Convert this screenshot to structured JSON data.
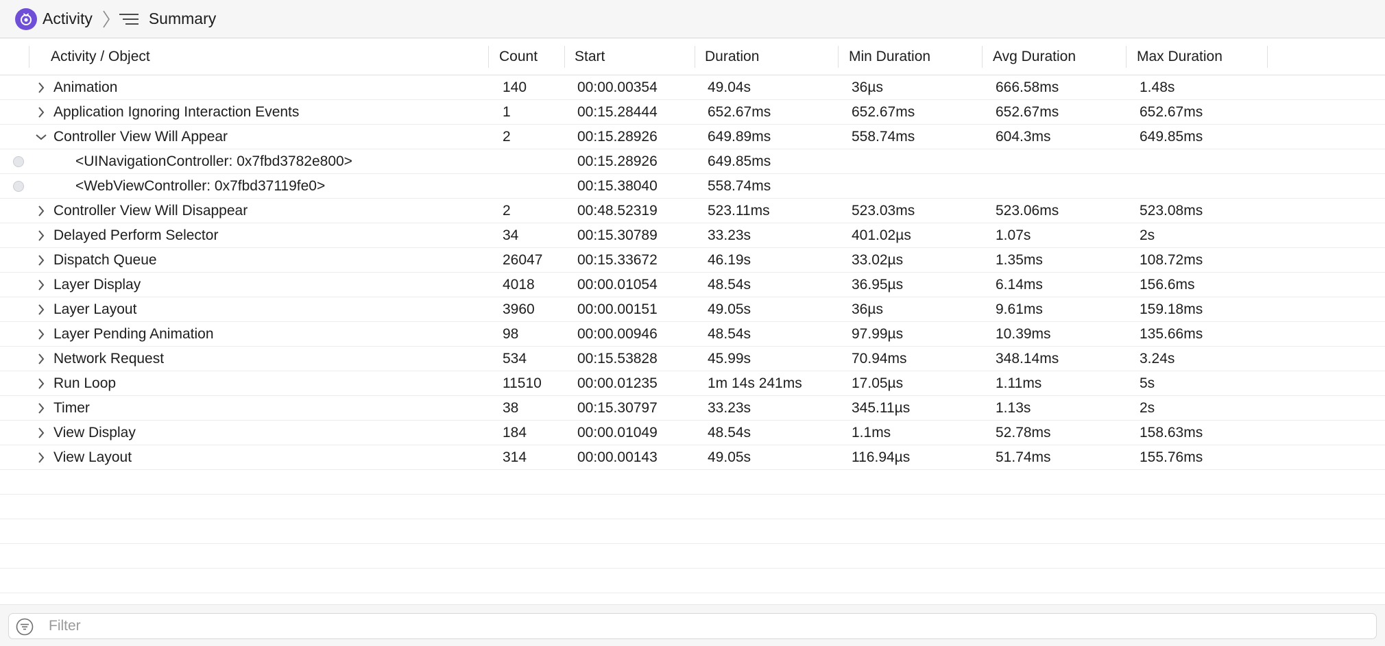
{
  "breadcrumb": {
    "app": "Activity",
    "view": "Summary"
  },
  "icons": {
    "app": "activity-app-icon",
    "separator": "chevron-right-icon",
    "summary": "summary-lines-icon",
    "expand": "chevron-right-icon",
    "collapse": "chevron-down-icon",
    "filter": "filter-icon"
  },
  "colors": {
    "accent": "#6f4fd8"
  },
  "table": {
    "columns": [
      "Activity / Object",
      "Count",
      "Start",
      "Duration",
      "Min Duration",
      "Avg Duration",
      "Max Duration"
    ],
    "rows": [
      {
        "name": "Animation",
        "count": "140",
        "start": "00:00.00354",
        "duration": "49.04s",
        "min": "36µs",
        "avg": "666.58ms",
        "max": "1.48s",
        "state": "collapsed"
      },
      {
        "name": "Application Ignoring Interaction Events",
        "count": "1",
        "start": "00:15.28444",
        "duration": "652.67ms",
        "min": "652.67ms",
        "avg": "652.67ms",
        "max": "652.67ms",
        "state": "collapsed"
      },
      {
        "name": "Controller View Will Appear",
        "count": "2",
        "start": "00:15.28926",
        "duration": "649.89ms",
        "min": "558.74ms",
        "avg": "604.3ms",
        "max": "649.85ms",
        "state": "expanded"
      },
      {
        "name": "<UINavigationController: 0x7fbd3782e800>",
        "count": "",
        "start": "00:15.28926",
        "duration": "649.85ms",
        "min": "",
        "avg": "",
        "max": "",
        "state": "child"
      },
      {
        "name": "<WebViewController: 0x7fbd37119fe0>",
        "count": "",
        "start": "00:15.38040",
        "duration": "558.74ms",
        "min": "",
        "avg": "",
        "max": "",
        "state": "child"
      },
      {
        "name": "Controller View Will Disappear",
        "count": "2",
        "start": "00:48.52319",
        "duration": "523.11ms",
        "min": "523.03ms",
        "avg": "523.06ms",
        "max": "523.08ms",
        "state": "collapsed"
      },
      {
        "name": "Delayed Perform Selector",
        "count": "34",
        "start": "00:15.30789",
        "duration": "33.23s",
        "min": "401.02µs",
        "avg": "1.07s",
        "max": "2s",
        "state": "collapsed"
      },
      {
        "name": "Dispatch Queue",
        "count": "26047",
        "start": "00:15.33672",
        "duration": "46.19s",
        "min": "33.02µs",
        "avg": "1.35ms",
        "max": "108.72ms",
        "state": "collapsed"
      },
      {
        "name": "Layer Display",
        "count": "4018",
        "start": "00:00.01054",
        "duration": "48.54s",
        "min": "36.95µs",
        "avg": "6.14ms",
        "max": "156.6ms",
        "state": "collapsed"
      },
      {
        "name": "Layer Layout",
        "count": "3960",
        "start": "00:00.00151",
        "duration": "49.05s",
        "min": "36µs",
        "avg": "9.61ms",
        "max": "159.18ms",
        "state": "collapsed"
      },
      {
        "name": "Layer Pending Animation",
        "count": "98",
        "start": "00:00.00946",
        "duration": "48.54s",
        "min": "97.99µs",
        "avg": "10.39ms",
        "max": "135.66ms",
        "state": "collapsed"
      },
      {
        "name": "Network Request",
        "count": "534",
        "start": "00:15.53828",
        "duration": "45.99s",
        "min": "70.94ms",
        "avg": "348.14ms",
        "max": "3.24s",
        "state": "collapsed"
      },
      {
        "name": "Run Loop",
        "count": "11510",
        "start": "00:00.01235",
        "duration": "1m 14s 241ms",
        "min": "17.05µs",
        "avg": "1.11ms",
        "max": "5s",
        "state": "collapsed"
      },
      {
        "name": "Timer",
        "count": "38",
        "start": "00:15.30797",
        "duration": "33.23s",
        "min": "345.11µs",
        "avg": "1.13s",
        "max": "2s",
        "state": "collapsed"
      },
      {
        "name": "View Display",
        "count": "184",
        "start": "00:00.01049",
        "duration": "48.54s",
        "min": "1.1ms",
        "avg": "52.78ms",
        "max": "158.63ms",
        "state": "collapsed"
      },
      {
        "name": "View Layout",
        "count": "314",
        "start": "00:00.00143",
        "duration": "49.05s",
        "min": "116.94µs",
        "avg": "51.74ms",
        "max": "155.76ms",
        "state": "collapsed"
      }
    ]
  },
  "filter": {
    "placeholder": "Filter",
    "value": ""
  }
}
